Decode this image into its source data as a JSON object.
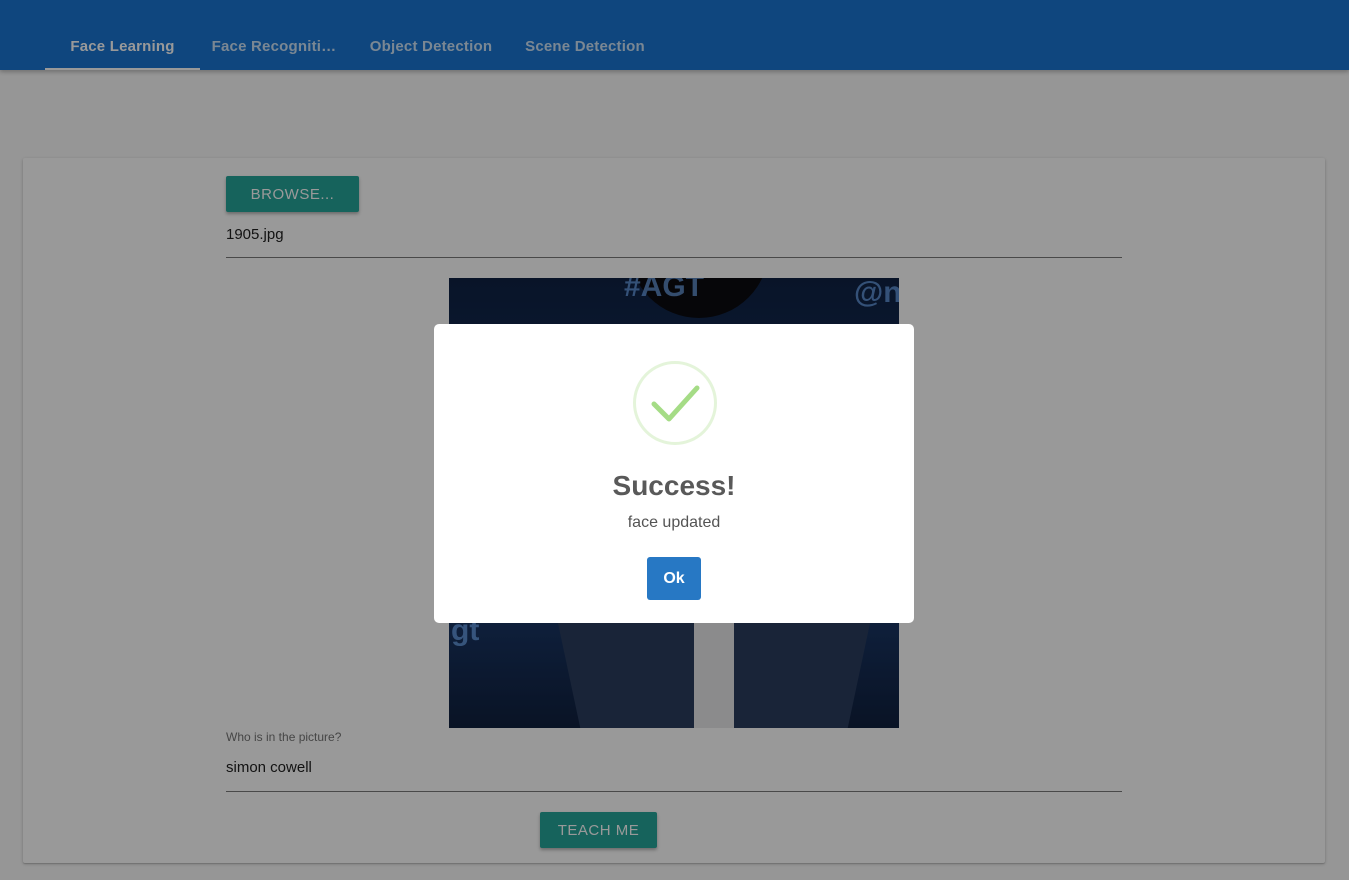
{
  "tabs": [
    {
      "label": "Face Learning",
      "active": true
    },
    {
      "label": "Face Recogniti…",
      "active": false
    },
    {
      "label": "Object Detection",
      "active": false
    },
    {
      "label": "Scene Detection",
      "active": false
    }
  ],
  "upload": {
    "browse_label": "BROWSE...",
    "file_name": "1905.jpg"
  },
  "photo_text": {
    "top": "#AGT",
    "top_right": "@n",
    "left": "gt"
  },
  "name_field": {
    "label": "Who is in the picture?",
    "value": "simon cowell"
  },
  "teach_button": "TEACH ME",
  "dialog": {
    "icon": "success-check-icon",
    "title": "Success!",
    "text": "face updated",
    "ok_label": "Ok"
  },
  "colors": {
    "appbar": "#1976d2",
    "button": "#26a69a",
    "ok_button": "#2778c4",
    "success": "#a5dc86"
  }
}
